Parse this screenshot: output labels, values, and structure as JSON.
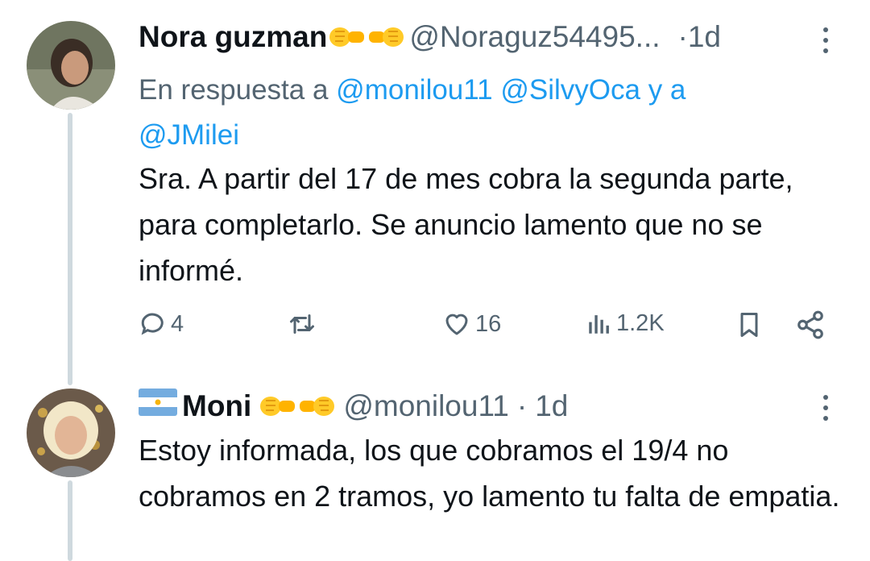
{
  "tweets": [
    {
      "author_name": "Nora guzman",
      "handle": "@Noraguz54495...",
      "separator": "·",
      "time": "1d",
      "reply_to_prefix": "En respuesta a",
      "reply_to_1": "@monilou11",
      "reply_to_2": "@SilvyOca",
      "reply_to_and": "y a",
      "reply_to_3": "@JMilei",
      "text": "Sra. A partir del 17 de mes cobra la segunda parte, para completarlo. Se anuncio lamento que no se informé.",
      "actions": {
        "replies": "4",
        "retweets": "",
        "likes": "16",
        "views": "1.2K"
      }
    },
    {
      "author_name": "Moni",
      "handle": "@monilou11",
      "separator": "·",
      "time": "1d",
      "text": "Estoy informada, los que cobramos el 19/4 no cobramos en 2 tramos, yo lamento tu falta de empatia."
    }
  ],
  "colors": {
    "text_primary": "#0f1419",
    "text_secondary": "#536471",
    "link": "#1d9bf0",
    "thread_line": "#cfd9de",
    "emoji_yellow": "#ffca28"
  },
  "icons": [
    "reply-icon",
    "retweet-icon",
    "like-icon",
    "views-icon",
    "bookmark-icon",
    "share-icon",
    "more-options-icon",
    "fist-bump-emoji",
    "argentina-flag-emoji"
  ]
}
